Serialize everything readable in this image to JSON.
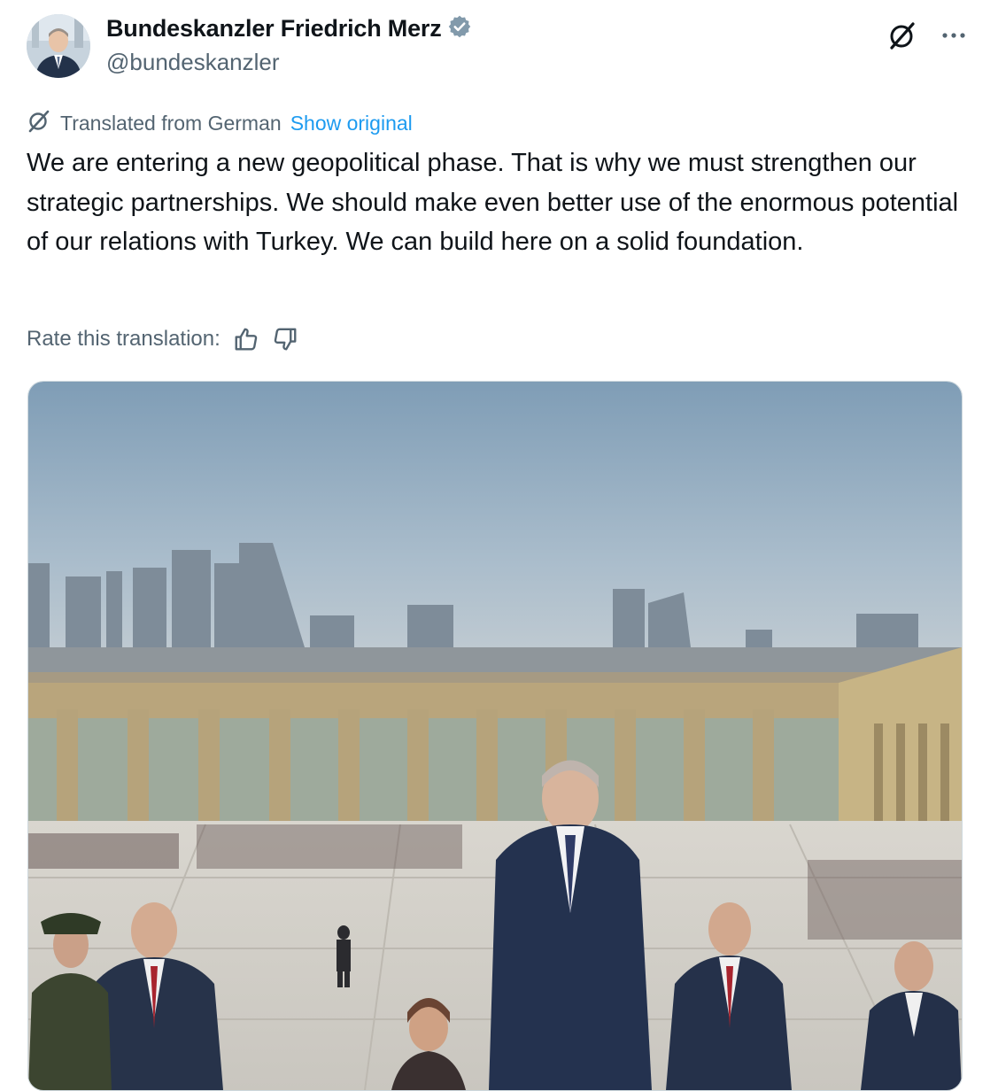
{
  "author": {
    "display_name": "Bundeskanzler Friedrich Merz",
    "handle": "@bundeskanzler",
    "verified_icon": "verified-badge-icon",
    "verified_color": "#829aab"
  },
  "actions": {
    "grok_icon": "grok-icon",
    "more_icon": "more-icon"
  },
  "translation": {
    "icon": "translate-icon",
    "label": "Translated from German",
    "show_original": "Show original",
    "link_color": "#1d9bf0"
  },
  "tweet": {
    "text": "We are entering a new geopolitical phase. That is why we must strengthen our strategic partnerships. We should make even better use of the enormous potential of our relations with Turkey. We can build here on a solid foundation."
  },
  "rating": {
    "label": "Rate this translation:",
    "thumbs_up_icon": "thumbs-up-icon",
    "thumbs_down_icon": "thumbs-down-icon"
  },
  "media": {
    "type": "photo"
  }
}
